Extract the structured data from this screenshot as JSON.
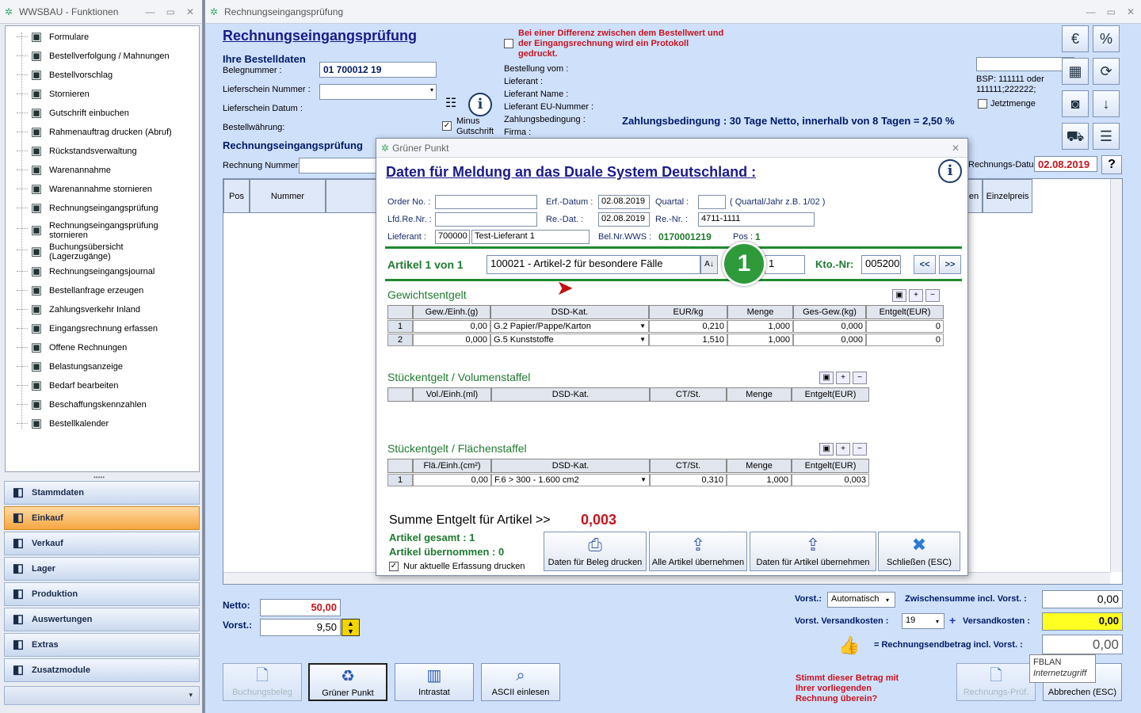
{
  "left": {
    "title": "WWSBAU - Funktionen",
    "tree": [
      {
        "label": "Formulare",
        "icon": "document-icon"
      },
      {
        "label": "Bestellverfolgung / Mahnungen",
        "icon": "map-icon"
      },
      {
        "label": "Bestellvorschlag",
        "icon": "cart-icon"
      },
      {
        "label": "Stornieren",
        "icon": "cart-cancel-icon"
      },
      {
        "label": "Gutschrift einbuchen",
        "icon": "calculator-icon"
      },
      {
        "label": "Rahmenauftrag drucken (Abruf)",
        "icon": "print-document-icon"
      },
      {
        "label": "Rückstandsverwaltung",
        "icon": "clock-icon"
      },
      {
        "label": "Warenannahme",
        "icon": "goods-receipt-icon"
      },
      {
        "label": "Warenannahme stornieren",
        "icon": "goods-receipt-cancel-icon"
      },
      {
        "label": "Rechnungseingangsprüfung",
        "icon": "invoice-check-icon"
      },
      {
        "label": "Rechnungseingangsprüfung stornieren",
        "icon": "invoice-cancel-icon"
      },
      {
        "label": "Buchungsübersicht (Lagerzugänge)",
        "icon": "booking-overview-icon"
      },
      {
        "label": "Rechnungseingangsjournal",
        "icon": "journal-icon"
      },
      {
        "label": "Bestellanfrage erzeugen",
        "icon": "order-request-icon"
      },
      {
        "label": "Zahlungsverkehr Inland",
        "icon": "payment-icon"
      },
      {
        "label": "Eingangsrechnung erfassen",
        "icon": "euro-invoice-icon"
      },
      {
        "label": "Offene Rechnungen",
        "icon": "open-invoice-icon"
      },
      {
        "label": "Belastungsanzeige",
        "icon": "weight-icon"
      },
      {
        "label": "Bedarf bearbeiten",
        "icon": "keyboard-icon"
      },
      {
        "label": "Beschaffungskennzahlen",
        "icon": "calendar-stats-icon"
      },
      {
        "label": "Bestellkalender",
        "icon": "calendar-icon"
      }
    ],
    "nav": [
      {
        "label": "Stammdaten",
        "icon": "master-data-icon",
        "active": false
      },
      {
        "label": "Einkauf",
        "icon": "purchase-cart-icon",
        "active": true
      },
      {
        "label": "Verkauf",
        "icon": "sales-register-icon",
        "active": false
      },
      {
        "label": "Lager",
        "icon": "warehouse-icon",
        "active": false
      },
      {
        "label": "Produktion",
        "icon": "production-icon",
        "active": false
      },
      {
        "label": "Auswertungen",
        "icon": "analytics-icon",
        "active": false
      },
      {
        "label": "Extras",
        "icon": "extras-icon",
        "active": false
      },
      {
        "label": "Zusatzmodule",
        "icon": "modules-icon",
        "active": false
      }
    ]
  },
  "main": {
    "title": "Rechnungseingangsprüfung",
    "heading": "Rechnungseingangsprüfung",
    "bestelldaten_title": "Ihre Bestelldaten",
    "belegnummer_label": "Belegnummer :",
    "belegnummer_value": "01 700012 19",
    "lieferschein_nr_label": "Lieferschein Nummer :",
    "lieferschein_datum_label": "Lieferschein Datum :",
    "bestellwaehrung_label": "Bestellwährung:",
    "minus_label": "Minus",
    "gutschrift_label": "Gutschrift",
    "protocol_text": "Bei einer Differenz zwischen dem Bestellwert und der Eingangsrechnung wird ein Protokoll gedruckt.",
    "bestellung_vom": "Bestellung vom :",
    "lieferant": "Lieferant :",
    "lieferant_name": "Lieferant Name :",
    "lieferant_eu": "Lieferant EU-Nummer :",
    "zahlungsbedingung": "Zahlungsbedingung :",
    "firma": "Firma :",
    "zahlungsbedingung_text": "Zahlungsbedingung : 30 Tage Netto, innerhalb von 8 Tagen = 2,50 %",
    "bsp_text": "BSP: 111111 oder 111111;222222;",
    "jetztmenge": "Jetztmenge",
    "section2": "Rechnungseingangsprüfung",
    "rechnung_nummer": "Rechnung Nummer",
    "rechnungs_datum_label": "Rechnungs-Datum :",
    "rechnungs_datum": "02.08.2019",
    "grid_headers": [
      "Pos",
      "Nummer",
      "en",
      "Einzelpreis"
    ],
    "netto_label": "Netto:",
    "netto_value": "50,00",
    "vorst_label": "Vorst.:",
    "vorst_value": "9,50",
    "vorst_mode_label": "Vorst.:",
    "vorst_mode": "Automatisch",
    "zwischensumme_label": "Zwischensumme incl. Vorst. :",
    "zwischensumme": "0,00",
    "vorst_versand_label": "Vorst. Versandkosten :",
    "vorst_versand": "19",
    "versandkosten_label": "Versandkosten :",
    "versandkosten": "0,00",
    "endbetrag_label": "= Rechnungsendbetrag incl. Vorst. :",
    "endbetrag": "0,00",
    "question_text": "Stimmt dieser Betrag mit Ihrer vorliegenden Rechnung überein?",
    "buttons": [
      "Buchungsbeleg",
      "Grüner Punkt",
      "Intrastat",
      "ASCII einlesen"
    ],
    "btn_pruef": "Rechnungs-Prüf.",
    "btn_abbrechen": "Abbrechen (ESC)",
    "tooltip_title": "FBLAN",
    "tooltip_sub": "Internetzugriff",
    "help": "?"
  },
  "dialog": {
    "title": "Grüner Punkt",
    "heading": "Daten für Meldung an das Duale System Deutschland :",
    "order_no_label": "Order No. :",
    "lfd_label": "Lfd.Re.Nr. :",
    "lieferant_label": "Lieferant :",
    "lieferant_nr": "700000",
    "lieferant_name": "Test-Lieferant 1",
    "erf_datum_label": "Erf.-Datum :",
    "erf_datum": "02.08.2019",
    "re_dat_label": "Re.-Dat. :",
    "re_dat": "02.08.2019",
    "bel_label": "Bel.Nr.WWS :",
    "bel_value": "0170001219",
    "quartal_label": "Quartal :",
    "quartal_hint": "( Quartal/Jahr z.B. 1/02 )",
    "re_nr_label": "Re.-Nr. :",
    "re_nr": "4711-1111",
    "pos_label": "Pos :",
    "pos_value": "1",
    "artikel_label": "Artikel 1 von 1",
    "artikel_value": "100021 - Artikel-2 für besondere Fälle",
    "menge_value": "1",
    "kto_label": "Kto.-Nr:",
    "kto_value": "005200",
    "prev": "<<",
    "next": ">>",
    "badge": "1",
    "gewicht_title": "Gewichtsentgelt",
    "gewicht_headers": [
      "Gew./Einh.(g)",
      "DSD-Kat.",
      "EUR/kg",
      "Menge",
      "Ges-Gew.(kg)",
      "Entgelt(EUR)"
    ],
    "gewicht_rows": [
      {
        "n": "1",
        "gew": "0,00",
        "kat": "G.2   Papier/Pappe/Karton",
        "eur": "0,210",
        "menge": "1,000",
        "ges": "0,000",
        "ent": "0"
      },
      {
        "n": "2",
        "gew": "0,000",
        "kat": "G.5   Kunststoffe",
        "eur": "1,510",
        "menge": "1,000",
        "ges": "0,000",
        "ent": "0"
      }
    ],
    "stueck_title": "Stückentgelt / Volumenstaffel",
    "stueck_headers": [
      "Vol./Einh.(ml)",
      "DSD-Kat.",
      "CT/St.",
      "Menge",
      "Entgelt(EUR)"
    ],
    "flaeche_title": "Stückentgelt / Flächenstaffel",
    "flaeche_headers": [
      "Flä./Einh.(cm²)",
      "DSD-Kat.",
      "CT/St.",
      "Menge",
      "Entgelt(EUR)"
    ],
    "flaeche_rows": [
      {
        "n": "1",
        "fl": "0,00",
        "kat": "F.6   > 300 - 1.600 cm2",
        "ct": "0,310",
        "menge": "1,000",
        "ent": "0,003"
      }
    ],
    "summe_label": "Summe Entgelt für Artikel >>",
    "summe_value": "0,003",
    "artikel_gesamt": "Artikel gesamt : 1",
    "artikel_uebernommen": "Artikel übernommen : 0",
    "nur_aktuelle": "Nur aktuelle Erfassung drucken",
    "btn1": "Daten für Beleg drucken",
    "btn2": "Alle Artikel übernehmen",
    "btn3": "Daten für Artikel übernehmen",
    "btn4": "Schließen (ESC)"
  }
}
